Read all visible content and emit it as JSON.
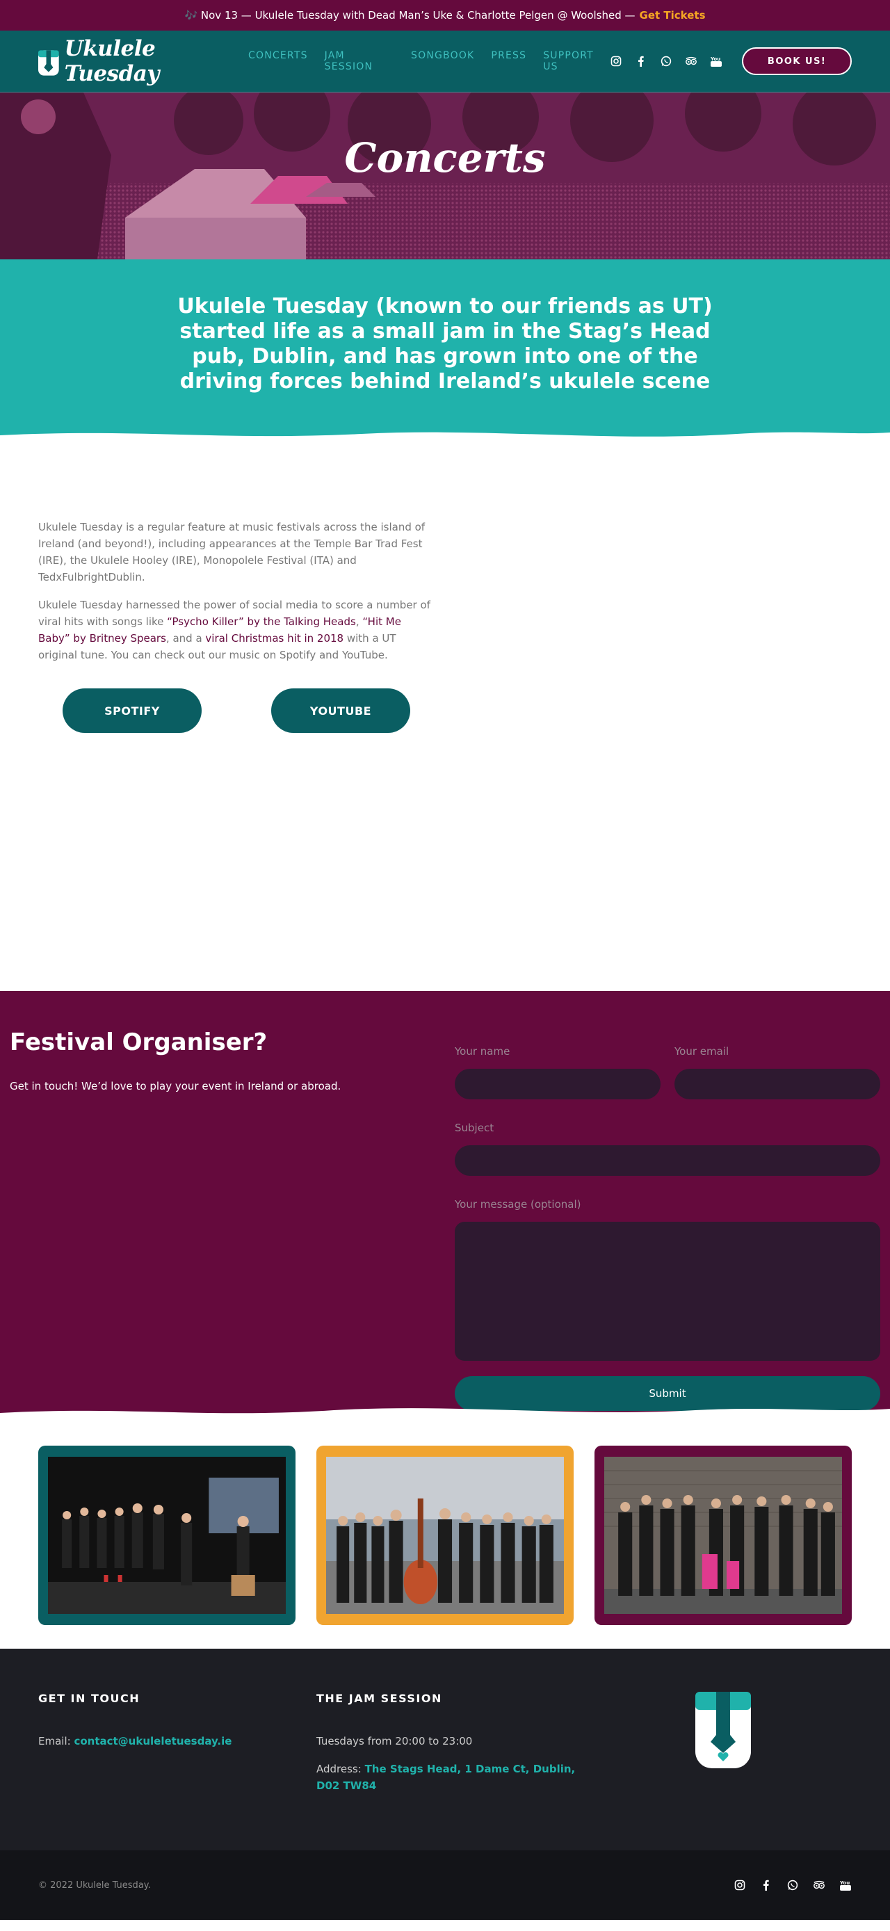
{
  "announcement": {
    "text": "🎶 Nov 13 — Ukulele Tuesday with Dead Man’s Uke & Charlotte Pelgen @ Woolshed —",
    "link": "Get Tickets"
  },
  "header": {
    "logo_text": "Ukulele Tuesday",
    "nav": [
      "Concerts",
      "Jam Session",
      "Songbook",
      "Press",
      "Support Us"
    ],
    "social_icons": [
      "instagram-icon",
      "facebook-icon",
      "whatsapp-icon",
      "tripadvisor-icon",
      "youtube-icon"
    ],
    "book_label": "BOOK US!"
  },
  "hero": {
    "title": "Concerts"
  },
  "intro": {
    "text": "Ukulele Tuesday (known to our friends as UT) started life as a small jam in the Stag’s Head pub, Dublin, and has grown into one of the driving forces behind Ireland’s ukulele scene"
  },
  "body": {
    "p1": "Ukulele Tuesday is a regular feature at music festivals across the island of Ireland (and beyond!), including appearances at the Temple Bar Trad Fest (IRE), the Ukulele Hooley (IRE), Monopolele Festival (ITA) and TedxFulbrightDublin.",
    "p2_a": "Ukulele Tuesday harnessed the power of social media to score a number of viral hits with songs like ",
    "p2_link1": "“Psycho Killer” by the Talking Heads",
    "p2_b": ", ",
    "p2_link2": "“Hit Me Baby” by Britney Spears",
    "p2_c": ", and a ",
    "p2_link3": "viral Christmas hit in 2018",
    "p2_d": " with a UT original tune. You can check out our music on Spotify and YouTube.",
    "spotify": "SPOTIFY",
    "youtube": "YOUTUBE"
  },
  "festival": {
    "title": "Festival Organiser?",
    "subtitle": "Get in touch! We’d love to play your event in Ireland or abroad.",
    "name_label": "Your name",
    "email_label": "Your email",
    "subject_label": "Subject",
    "message_label": "Your message (optional)",
    "submit": "Submit"
  },
  "photos": [
    {
      "frame": "#0a5e62"
    },
    {
      "frame": "#f0a430"
    },
    {
      "frame": "#650a3d"
    }
  ],
  "footer": {
    "col1_title": "GET IN TOUCH",
    "email_prefix": "Email:",
    "email": "contact@ukuleletuesday.ie",
    "col2_title": "THE JAM SESSION",
    "times": "Tuesdays from 20:00 to 23:00",
    "address_prefix": "Address:",
    "address": "The Stags Head, 1 Dame Ct, Dublin, D02 TW84",
    "copyright": "© 2022 Ukulele Tuesday."
  },
  "colors": {
    "teal_dark": "#0a5e62",
    "teal": "#20b2ab",
    "plum": "#650a3d",
    "orange": "#f5a623"
  }
}
